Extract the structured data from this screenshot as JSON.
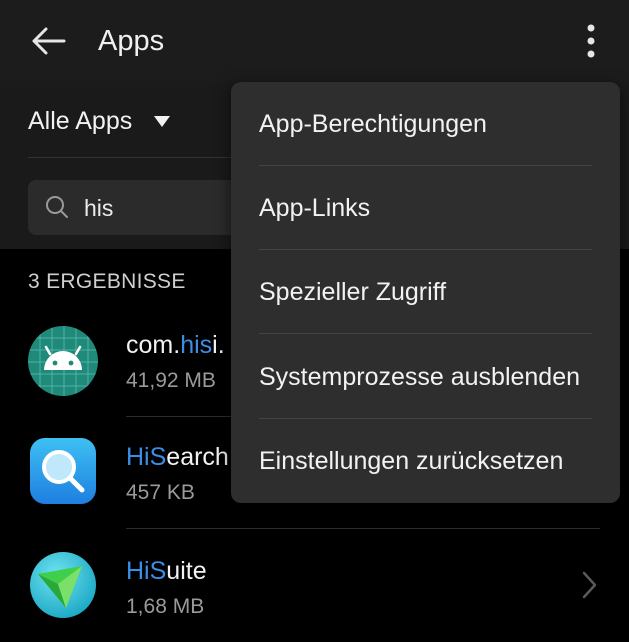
{
  "toolbar": {
    "title": "Apps",
    "back_icon": "arrow-left-icon",
    "overflow_icon": "more-vertical-icon"
  },
  "filter": {
    "label": "Alle Apps",
    "caret_icon": "caret-down-icon"
  },
  "search": {
    "icon": "search-icon",
    "value": "his"
  },
  "results": {
    "header": "3 ERGEBNISSE"
  },
  "apps": [
    {
      "name_highlight_prefix": "com.",
      "name_highlight": "his",
      "name_rest": "i.",
      "size": "41,92 MB",
      "icon": "android-icon"
    },
    {
      "name_highlight_prefix": "",
      "name_highlight": "HiS",
      "name_rest": "earch",
      "size": "457 KB",
      "icon": "magnifier-app-icon"
    },
    {
      "name_highlight_prefix": "",
      "name_highlight": "HiS",
      "name_rest": "uite",
      "size": "1,68 MB",
      "icon": "hisuite-icon"
    }
  ],
  "menu": {
    "items": [
      {
        "label": "App-Berechtigungen"
      },
      {
        "label": "App-Links"
      },
      {
        "label": "Spezieller Zugriff"
      },
      {
        "label": "Systemprozesse ausblenden"
      },
      {
        "label": "Einstellungen zurücksetzen"
      }
    ]
  },
  "colors": {
    "highlight": "#3a8ee6",
    "background": "#000000",
    "menu_bg": "#2e2e2e"
  }
}
